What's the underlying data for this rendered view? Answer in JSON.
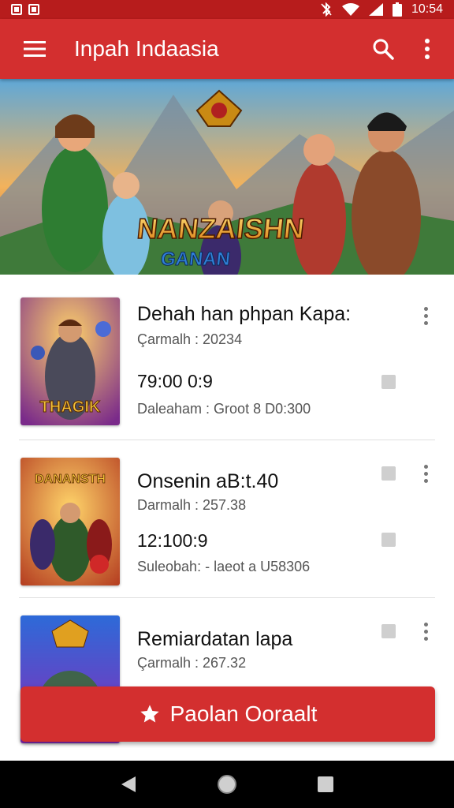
{
  "status_bar": {
    "time": "10:54"
  },
  "app_bar": {
    "title": "Inpah Indaasia"
  },
  "banner": {
    "logo_line1": "NANZAISHN",
    "logo_line2": "GANAN"
  },
  "items": [
    {
      "title": "Dehah han phpan Kapa:",
      "subtitle": "Çarmalh : 20234",
      "time": "79:00 0:9",
      "meta": "Daleaham : Groot 8 D0:300",
      "thumb_label": "THAGIK"
    },
    {
      "title": "Onsenin aB:t.40",
      "subtitle": "Darmalh : 257.38",
      "time": "12:100:9",
      "meta": "Suleobah: - laeot a U58306",
      "thumb_label": "DANANSTH"
    },
    {
      "title": "Remiardatan lapa",
      "subtitle": "Çarmalh : 267.32",
      "time": "",
      "meta": "",
      "thumb_label": ""
    }
  ],
  "action_button": {
    "label": "Paolan Ooraalt",
    "icon": "star-icon"
  },
  "colors": {
    "primary": "#d32f2f",
    "status_bar": "#b71c1c",
    "nav_bar": "#000000"
  }
}
